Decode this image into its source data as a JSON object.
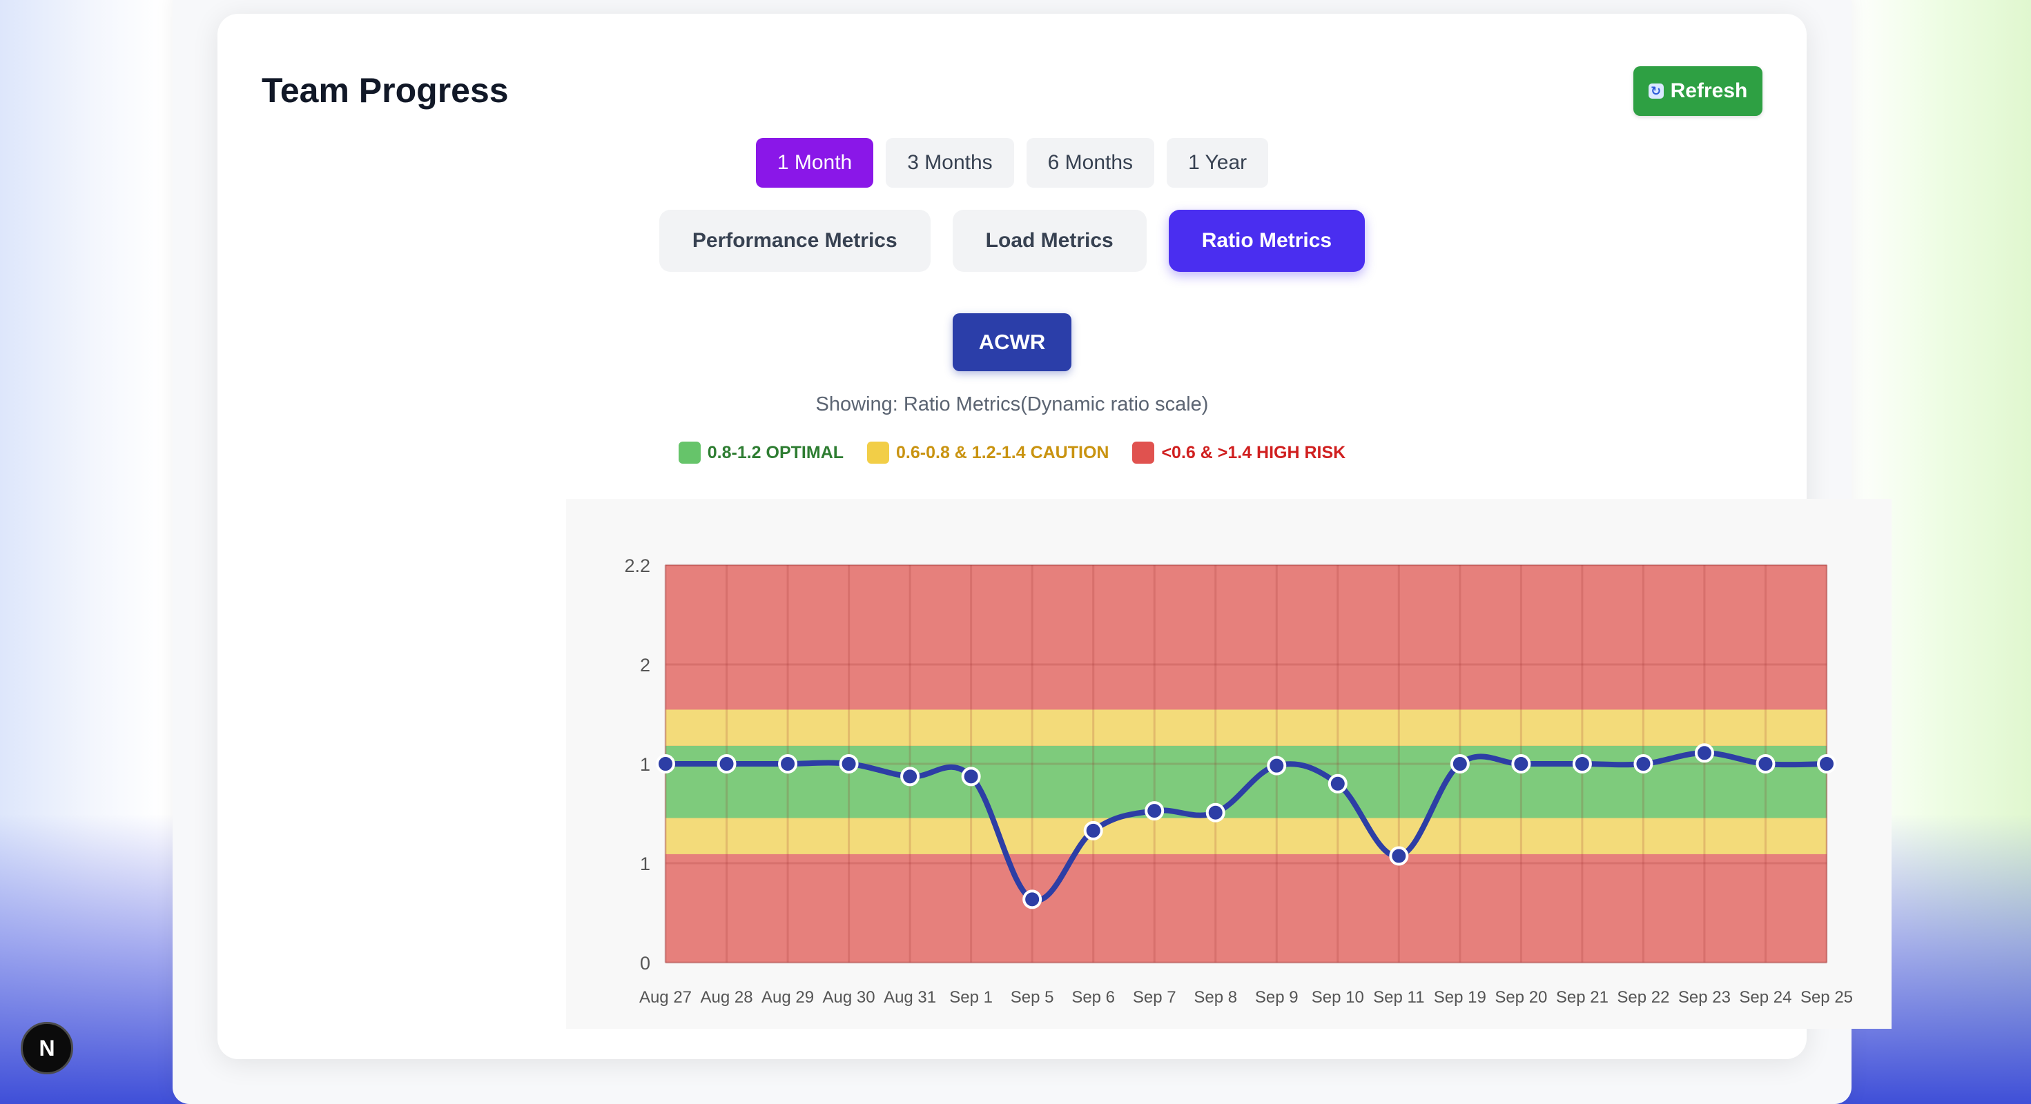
{
  "card": {
    "title": "Team Progress",
    "refresh_label": "Refresh"
  },
  "periods": [
    {
      "label": "1 Month",
      "active": true
    },
    {
      "label": "3 Months",
      "active": false
    },
    {
      "label": "6 Months",
      "active": false
    },
    {
      "label": "1 Year",
      "active": false
    }
  ],
  "metric_tabs": [
    {
      "label": "Performance Metrics",
      "active": false
    },
    {
      "label": "Load Metrics",
      "active": false
    },
    {
      "label": "Ratio Metrics",
      "active": true
    }
  ],
  "sub_metric": {
    "label": "ACWR"
  },
  "showing_text": "Showing: Ratio Metrics(Dynamic ratio scale)",
  "legend": [
    {
      "label": "0.8-1.2 OPTIMAL",
      "swatch_color": "#66c46a",
      "text_color": "#2e7d32"
    },
    {
      "label": "0.6-0.8 & 1.2-1.4 CAUTION",
      "swatch_color": "#f2ce47",
      "text_color": "#c99310"
    },
    {
      "label": "<0.6 & >1.4 HIGH RISK",
      "swatch_color": "#e0524f",
      "text_color": "#d01f1f"
    }
  ],
  "badge": {
    "label": "N"
  },
  "colors": {
    "line": "#2d3ea5",
    "optimal_band": "#7ecb7c",
    "caution_band": "#f3db7a",
    "risk_band": "#e6807c"
  },
  "chart_data": {
    "type": "line",
    "title": "",
    "xlabel": "",
    "ylabel": "",
    "ylim": [
      0,
      2.2
    ],
    "y_ticks": [
      0,
      0.55,
      1.1,
      1.65,
      2.2
    ],
    "y_tick_labels": [
      "0",
      "1",
      "1",
      "2",
      "2.2"
    ],
    "grid": true,
    "bands": [
      {
        "from": 0.6,
        "to": 0.8,
        "kind": "caution"
      },
      {
        "from": 0.8,
        "to": 1.2,
        "kind": "optimal"
      },
      {
        "from": 1.2,
        "to": 1.4,
        "kind": "caution"
      }
    ],
    "categories": [
      "Aug 27",
      "Aug 28",
      "Aug 29",
      "Aug 30",
      "Aug 31",
      "Sep 1",
      "Sep 5",
      "Sep 6",
      "Sep 7",
      "Sep 8",
      "Sep 9",
      "Sep 10",
      "Sep 11",
      "Sep 19",
      "Sep 20",
      "Sep 21",
      "Sep 22",
      "Sep 23",
      "Sep 24",
      "Sep 25"
    ],
    "series": [
      {
        "values": [
          1.1,
          1.1,
          1.1,
          1.1,
          1.03,
          1.03,
          0.35,
          0.73,
          0.84,
          0.83,
          1.09,
          0.99,
          0.59,
          1.1,
          1.1,
          1.1,
          1.1,
          1.16,
          1.1,
          1.1
        ]
      }
    ]
  }
}
